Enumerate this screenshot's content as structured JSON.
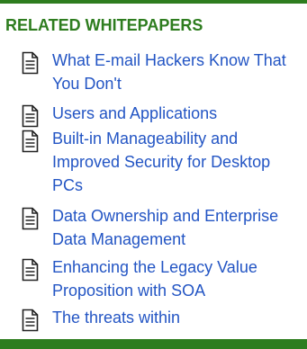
{
  "section": {
    "heading": "RELATED WHITEPAPERS"
  },
  "colors": {
    "accent_green": "#2e7d1f",
    "link_blue": "#2355c4"
  },
  "items": [
    {
      "label": "What E-mail Hackers Know That You Don't",
      "icon": "document-icon"
    },
    {
      "label": "Users and Applications",
      "icon": "document-icon"
    },
    {
      "label": "Built-in Manageability and Improved Security for Desktop PCs",
      "icon": "document-icon"
    },
    {
      "label": "Data Ownership and Enterprise Data Management",
      "icon": "document-icon"
    },
    {
      "label": "Enhancing the Legacy Value Proposition with SOA",
      "icon": "document-icon"
    },
    {
      "label": "The threats within",
      "icon": "document-icon"
    }
  ]
}
